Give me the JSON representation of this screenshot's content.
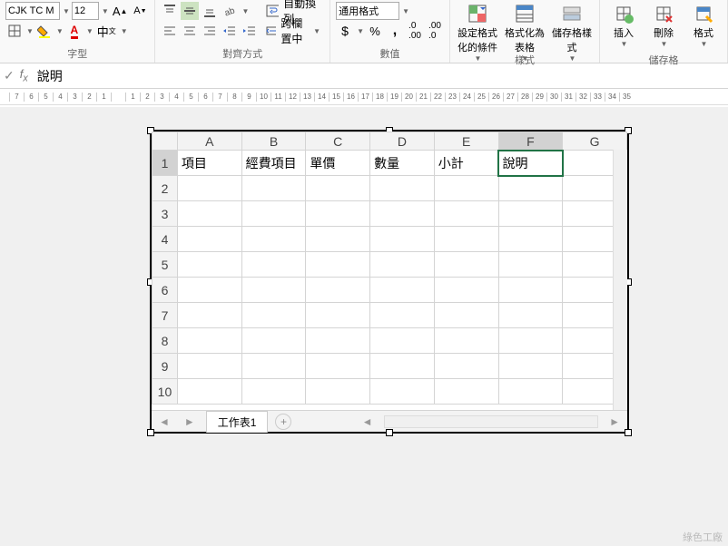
{
  "ribbon": {
    "font_name": "CJK TC M",
    "font_size": "12",
    "group_font": "字型",
    "group_align": "對齊方式",
    "group_number": "數值",
    "group_styles": "樣式",
    "group_cells": "儲存格",
    "wrap_text": "自動換列",
    "merge_center": "跨欄置中",
    "number_format": "通用格式",
    "cond_format": "設定格式化的條件",
    "format_table": "格式化為表格",
    "cell_styles": "儲存格樣式",
    "insert": "插入",
    "delete": "刪除",
    "format": "格式"
  },
  "formula": {
    "value": "說明"
  },
  "sheet": {
    "columns": [
      "A",
      "B",
      "C",
      "D",
      "E",
      "F",
      "G"
    ],
    "rows": [
      "1",
      "2",
      "3",
      "4",
      "5",
      "6",
      "7",
      "8",
      "9",
      "10"
    ],
    "active_col": "F",
    "active_row": "1",
    "data": {
      "A1": "項目",
      "B1": "經費項目",
      "C1": "單價",
      "D1": "數量",
      "E1": "小計",
      "F1": "說明"
    },
    "tab": "工作表1"
  },
  "ruler": [
    "7",
    "6",
    "5",
    "4",
    "3",
    "2",
    "1",
    "",
    "1",
    "2",
    "3",
    "4",
    "5",
    "6",
    "7",
    "8",
    "9",
    "10",
    "11",
    "12",
    "13",
    "14",
    "15",
    "16",
    "17",
    "18",
    "19",
    "20",
    "21",
    "22",
    "23",
    "24",
    "25",
    "26",
    "27",
    "28",
    "29",
    "30",
    "31",
    "32",
    "33",
    "34",
    "35"
  ],
  "watermark": "綠色工廠"
}
